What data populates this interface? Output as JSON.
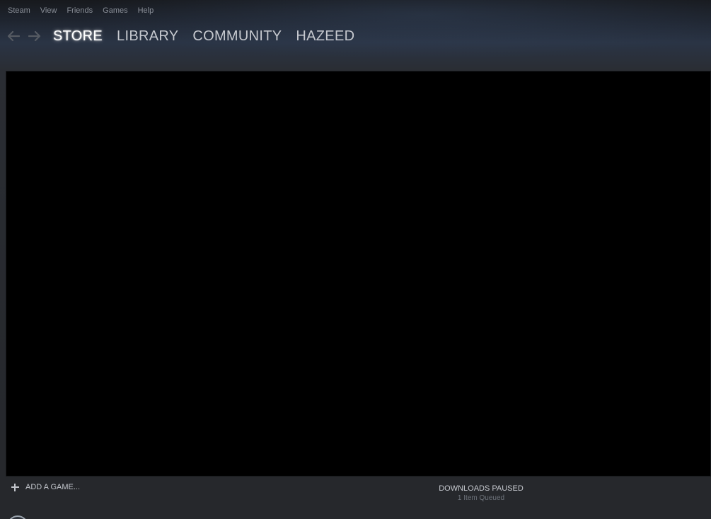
{
  "menu": {
    "items": [
      {
        "label": "Steam"
      },
      {
        "label": "View"
      },
      {
        "label": "Friends"
      },
      {
        "label": "Games"
      },
      {
        "label": "Help"
      }
    ]
  },
  "nav": {
    "back_icon": "arrow-left-icon",
    "forward_icon": "arrow-right-icon",
    "tabs": [
      {
        "label": "STORE",
        "active": true
      },
      {
        "label": "LIBRARY",
        "active": false
      },
      {
        "label": "COMMUNITY",
        "active": false
      },
      {
        "label": "HAZEED",
        "active": false
      }
    ]
  },
  "footer": {
    "add_game_label": "ADD A GAME...",
    "add_icon": "plus-icon",
    "downloads_status": "DOWNLOADS PAUSED",
    "downloads_sub": "1 Item Queued"
  },
  "colors": {
    "content_bg": "#000000",
    "active_tab": "#ffffff",
    "tab_text": "#c6c9cf",
    "menu_text": "#8a8f98"
  }
}
